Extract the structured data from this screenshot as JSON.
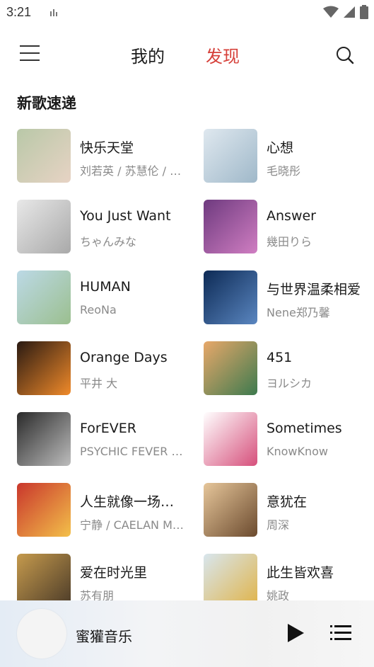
{
  "status_bar": {
    "time": "3:21"
  },
  "header": {
    "tabs": [
      {
        "label": "我的",
        "active": false
      },
      {
        "label": "发现",
        "active": true
      }
    ],
    "accent_color": "#d6403a"
  },
  "section": {
    "title": "新歌速递"
  },
  "songs": [
    {
      "title": "快乐天堂",
      "artist": "刘若英 / 苏慧伦 / 刘若英",
      "cover_colors": [
        "#b9c8a8",
        "#e7d3c4"
      ]
    },
    {
      "title": "心想",
      "artist": "毛晓彤",
      "cover_colors": [
        "#dfe8ef",
        "#9fb8c9"
      ]
    },
    {
      "title": "You Just Want",
      "artist": "ちゃんみな",
      "cover_colors": [
        "#e8e8e8",
        "#a9a9a9"
      ]
    },
    {
      "title": "Answer",
      "artist": "幾田りら",
      "cover_colors": [
        "#6e3a7f",
        "#d07ec2"
      ]
    },
    {
      "title": "HUMAN",
      "artist": "ReoNa",
      "cover_colors": [
        "#bcd9e6",
        "#9bbf8f"
      ]
    },
    {
      "title": "与世界温柔相爱",
      "artist": "Nene郑乃馨",
      "cover_colors": [
        "#0d2a55",
        "#5a86c0"
      ]
    },
    {
      "title": "Orange Days",
      "artist": "平井 大",
      "cover_colors": [
        "#2a1a12",
        "#f08a2a"
      ]
    },
    {
      "title": "451",
      "artist": "ヨルシカ",
      "cover_colors": [
        "#e8a86a",
        "#3d7a4e"
      ]
    },
    {
      "title": "ForEVER",
      "artist": "PSYCHIC FEVER from EXILE TRIBE",
      "cover_colors": [
        "#2a2a2a",
        "#bdbdbd"
      ]
    },
    {
      "title": "Sometimes",
      "artist": "KnowKnow",
      "cover_colors": [
        "#ffffff",
        "#d64f7b"
      ]
    },
    {
      "title": "人生就像一场修行",
      "artist": "宁静 / CAELAN MOORE",
      "cover_colors": [
        "#c9362c",
        "#f3c04a"
      ]
    },
    {
      "title": "意犹在",
      "artist": "周深",
      "cover_colors": [
        "#e6c69a",
        "#6b4a2e"
      ]
    },
    {
      "title": "爱在时光里",
      "artist": "苏有朋",
      "cover_colors": [
        "#c59a4d",
        "#4a3a28"
      ]
    },
    {
      "title": "此生皆欢喜",
      "artist": "姚政",
      "cover_colors": [
        "#d8e6ee",
        "#e0b347"
      ]
    }
  ],
  "player": {
    "name": "蜜獾音乐"
  },
  "icons": {
    "menu": "menu-icon",
    "search": "search-icon",
    "play": "play-icon",
    "queue": "playlist-icon"
  }
}
